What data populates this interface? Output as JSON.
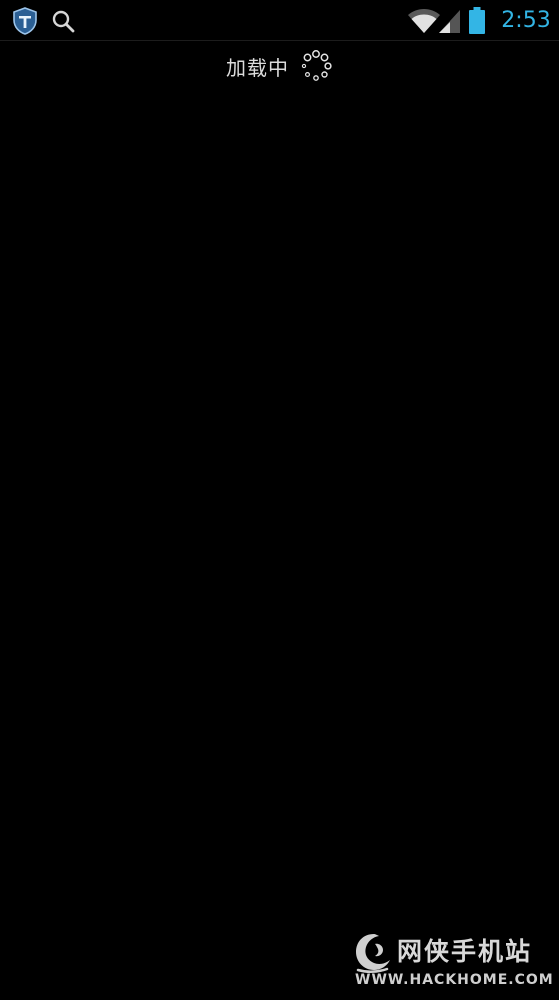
{
  "status_bar": {
    "time": "2:53",
    "icons": [
      "shield-icon",
      "search-icon",
      "wifi-icon",
      "signal-icon",
      "battery-icon"
    ],
    "accent_color": "#33b5e5"
  },
  "loading": {
    "label": "加载中",
    "icon": "spinner-icon"
  },
  "watermark": {
    "name_cn": "网侠手机站",
    "url": "WWW.HACKHOME.COM"
  }
}
